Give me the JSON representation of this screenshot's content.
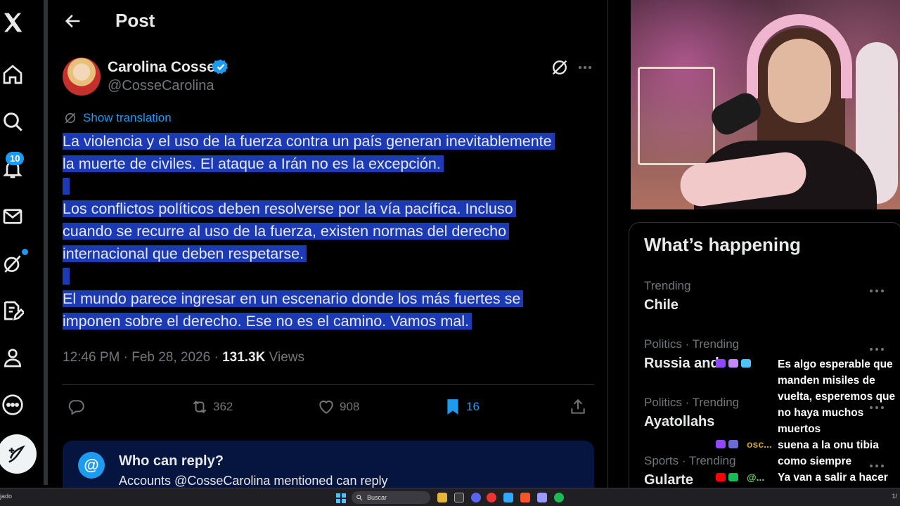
{
  "nav": {
    "notifications_badge": "10",
    "icons": [
      "x-logo-icon",
      "home-icon",
      "explore-icon",
      "notifications-icon",
      "messages-icon",
      "grok-icon",
      "drafts-icon",
      "profile-icon",
      "more-icon",
      "compose-icon"
    ]
  },
  "header": {
    "title": "Post"
  },
  "post": {
    "author_name": "Carolina Cosse",
    "handle": "@CosseCarolina",
    "show_translation": "Show translation",
    "paragraphs": [
      [
        "La violencia y el uso de la fuerza contra un país generan inevitablemente",
        "la muerte de civiles. El ataque a Irán no es la excepción."
      ],
      [
        "Los conflictos políticos deben resolverse por la vía pacífica. Incluso",
        "cuando se recurre al uso de la fuerza, existen normas del derecho",
        "internacional que deben respetarse."
      ],
      [
        "El mundo parece ingresar en un escenario donde los más fuertes se",
        "imponen sobre el derecho. Ese no es el camino. Vamos mal."
      ]
    ],
    "time": "12:46 PM · Feb 28, 2026 · ",
    "views_count": "131.3K",
    "views_label": " Views",
    "reposts": "362",
    "likes": "908",
    "bookmarks": "16"
  },
  "reply_box": {
    "title": "Who can reply?",
    "subtitle": "Accounts @CosseCarolina mentioned can reply"
  },
  "sidebar": {
    "title": "What’s happening",
    "trends": [
      {
        "context": "Trending",
        "name": "Chile"
      },
      {
        "context": "Politics · Trending",
        "name": "Russia and"
      },
      {
        "context": "Politics · Trending",
        "name": "Ayatollahs"
      },
      {
        "context": "Sports · Trending",
        "name": "Gularte"
      }
    ]
  },
  "chat": {
    "messages": [
      "Es algo esperable que manden misiles de vuelta, esperemos que no haya muchos muertos",
      "suena a la onu tibia como siempre",
      "Ya van a salir a hacer una marcha por Israel"
    ],
    "users": [
      "osc...",
      "@..."
    ]
  },
  "taskbar": {
    "left_text": "jado",
    "search_placeholder": "Buscar",
    "right_text": "1/"
  },
  "colors": {
    "accent": "#1d9bf0",
    "highlight": "#1c3ab6",
    "muted": "#71767b",
    "bookmark": "#1d9bf0"
  }
}
